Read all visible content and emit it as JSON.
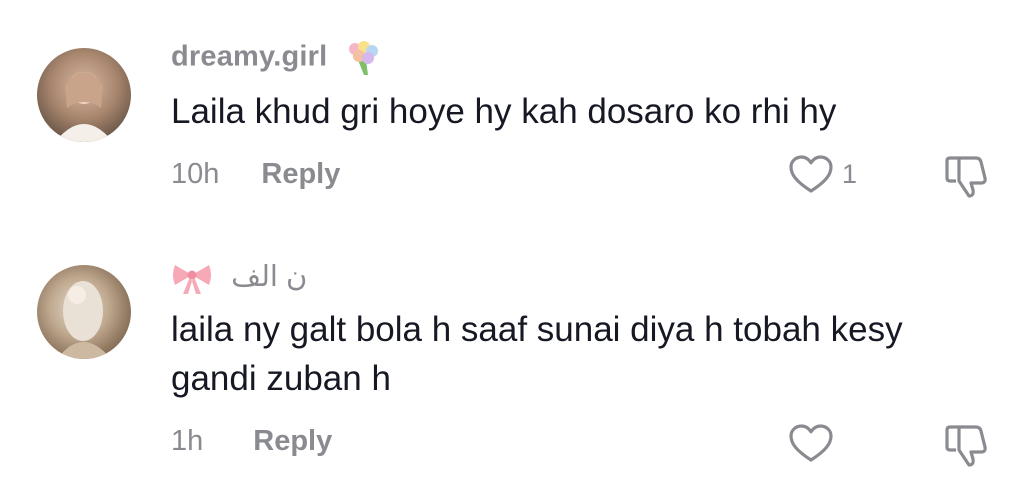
{
  "comments": [
    {
      "username": "dreamy.girl",
      "username_emoji": "bouquet-emoji",
      "text": "Laila khud gri hoye hy kah dosaro ko rhi hy",
      "time": "10h",
      "reply_label": "Reply",
      "like_count": "1",
      "liked": false
    },
    {
      "username": "ن الف",
      "username_emoji": "ribbon-emoji",
      "text": "laila ny galt bola h saaf sunai diya h tobah kesy gandi zuban h",
      "time": "1h",
      "reply_label": "Reply",
      "like_count": "",
      "liked": false
    }
  ],
  "colors": {
    "text": "#161823",
    "muted": "#8a8b91",
    "icon": "#8a8b91",
    "background": "#ffffff"
  }
}
